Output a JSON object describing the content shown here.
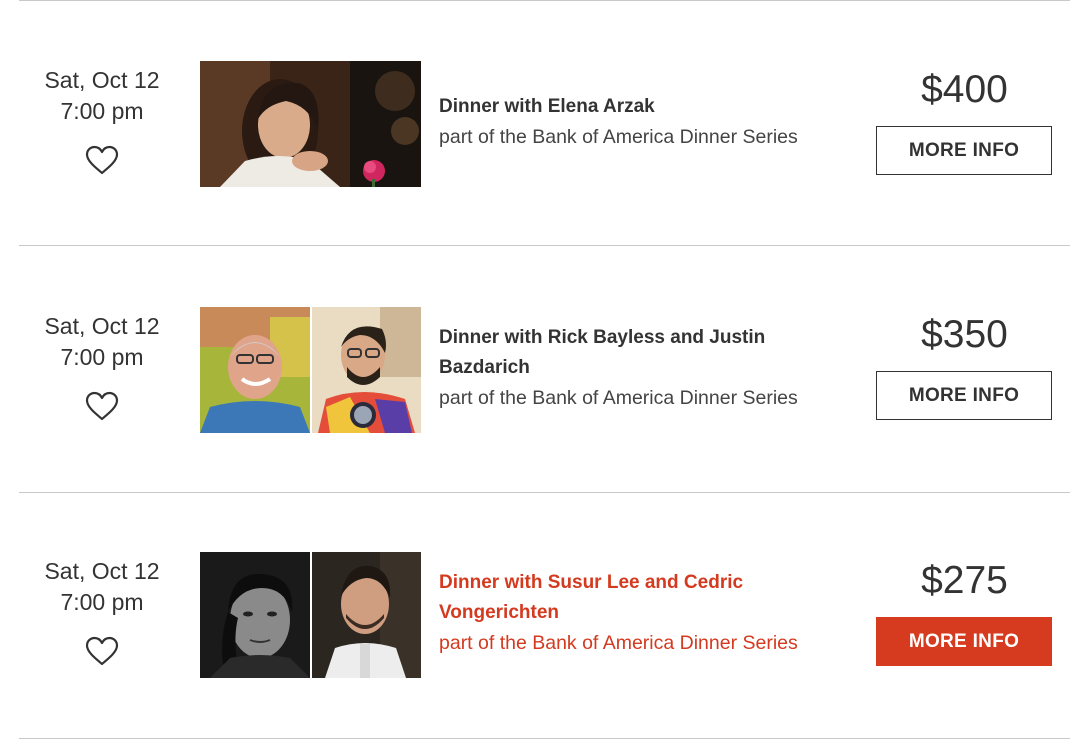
{
  "events": [
    {
      "date": "Sat, Oct 12",
      "time": "7:00 pm",
      "title_lines": [
        "Dinner with Elena Arzak"
      ],
      "series": "part of the Bank of America Dinner Series",
      "price": "$400",
      "button": "MORE INFO"
    },
    {
      "date": "Sat, Oct 12",
      "time": "7:00 pm",
      "title_lines": [
        "Dinner with Rick Bayless and Justin",
        "Bazdarich"
      ],
      "series": "part of the Bank of America Dinner Series",
      "price": "$350",
      "button": "MORE INFO"
    },
    {
      "date": "Sat, Oct 12",
      "time": "7:00 pm",
      "title_lines": [
        "Dinner with Susur Lee and Cedric",
        "Vongerichten"
      ],
      "series": "part of the Bank of America Dinner Series",
      "price": "$275",
      "button": "MORE INFO"
    }
  ],
  "icons": {
    "favorite": "heart-outline-icon"
  },
  "colors": {
    "accent": "#d63b1f",
    "text": "#333333",
    "divider": "#c9c9c9"
  }
}
